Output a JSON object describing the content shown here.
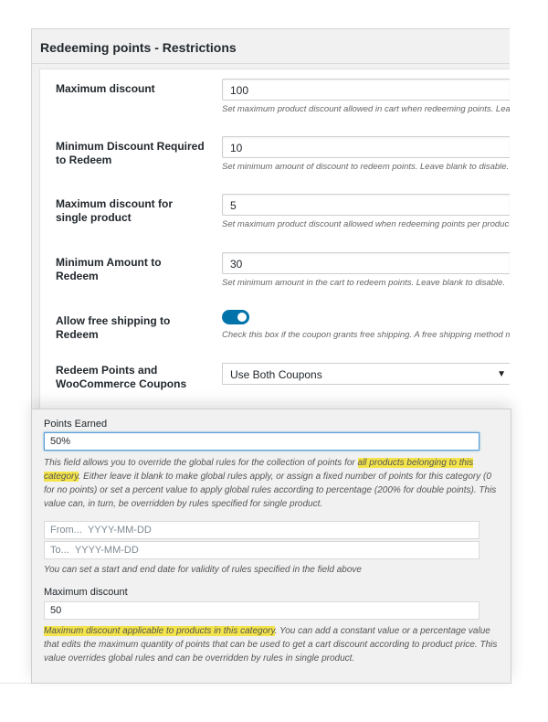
{
  "top_panel": {
    "title": "Redeeming points - Restrictions",
    "rows": [
      {
        "label": "Maximum discount",
        "value": "100",
        "desc": "Set maximum product discount allowed in cart when redeeming points. Leave"
      },
      {
        "label": "Minimum Discount Required to Redeem",
        "value": "10",
        "desc": "Set minimum amount of discount to redeem points. Leave blank to disable."
      },
      {
        "label": "Maximum discount for single product",
        "value": "5",
        "desc": "Set maximum product discount allowed when redeeming points per product."
      },
      {
        "label": "Minimum Amount to Redeem",
        "value": "30",
        "desc": "Set minimum amount in the cart to redeem points. Leave blank to disable."
      },
      {
        "label": "Allow free shipping to Redeem",
        "toggle_on": true,
        "desc": "Check this box if the coupon grants free shipping. A free shipping method mu"
      },
      {
        "label": "Redeem Points and WooCommerce Coupons",
        "select_value": "Use Both Coupons"
      }
    ],
    "toggle_color": "#0073aa"
  },
  "bottom_panel": {
    "points_earned_label": "Points Earned",
    "points_earned_value": "50%",
    "points_desc": {
      "part1": "This field allows you to override the global rules for the collection of points for ",
      "highlight1": "all products belonging to this category",
      "part2": ". Either leave it blank to make global rules apply, or assign a fixed number of points for this category (0 for no points) or set a percent value to apply global rules according to percentage (200% for double points). This value can, in turn, be overridden by rules specified for single product."
    },
    "from_placeholder_prefix": "From...",
    "from_placeholder": "YYYY-MM-DD",
    "to_placeholder_prefix": "To...",
    "to_placeholder": "YYYY-MM-DD",
    "date_desc": "You can set a start and end date for validity of rules specified in the field above",
    "max_discount_label": "Maximum discount",
    "max_discount_value": "50",
    "max_desc": {
      "highlight": "Maximum discount applicable to products in this category",
      "rest": ". You can add a constant value or a percentage value that edits the maximum quantity of points that can be used to get a cart discount according to product price. This value overrides global rules and can be overridden by rules in single product."
    },
    "highlight_color": "#f4e44b"
  }
}
